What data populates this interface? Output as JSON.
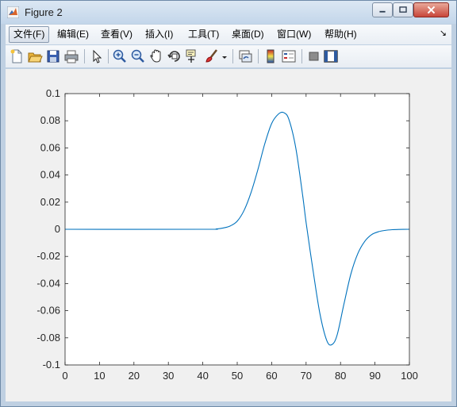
{
  "window": {
    "title": "Figure 2"
  },
  "menu": {
    "items": [
      "文件(F)",
      "编辑(E)",
      "查看(V)",
      "插入(I)",
      "工具(T)",
      "桌面(D)",
      "窗口(W)",
      "帮助(H)"
    ]
  },
  "toolbar": {
    "icons": [
      "new-figure-icon",
      "open-file-icon",
      "save-icon",
      "print-icon",
      "edit-plot-icon",
      "zoom-in-icon",
      "zoom-out-icon",
      "pan-icon",
      "rotate-3d-icon",
      "data-cursor-icon",
      "brush-icon",
      "link-plot-icon",
      "colorbar-icon",
      "legend-icon",
      "hide-plot-tools-icon",
      "show-plot-tools-icon"
    ]
  },
  "colors": {
    "line": "#0072bd",
    "axes_bg": "#ffffff",
    "figure_bg": "#f0f0f0"
  },
  "chart_data": {
    "type": "line",
    "x_ticks": [
      "0",
      "10",
      "20",
      "30",
      "40",
      "50",
      "60",
      "70",
      "80",
      "90",
      "100"
    ],
    "y_ticks": [
      "0.1",
      "0.08",
      "0.06",
      "0.04",
      "0.02",
      "0",
      "-0.02",
      "-0.04",
      "-0.06",
      "-0.08",
      "-0.1"
    ],
    "xlim": [
      0,
      100
    ],
    "ylim": [
      -0.1,
      0.1
    ],
    "grid": false,
    "series": [
      {
        "x": [
          0,
          40,
          44,
          46,
          48,
          50,
          52,
          54,
          56,
          58,
          60,
          62,
          63.5,
          65,
          67,
          69,
          70,
          72,
          74,
          76,
          77.5,
          79,
          81,
          83,
          85,
          87,
          89,
          91,
          93,
          95,
          97,
          100
        ],
        "y": [
          0,
          0,
          0.0003,
          0.001,
          0.0025,
          0.006,
          0.014,
          0.027,
          0.044,
          0.063,
          0.078,
          0.085,
          0.086,
          0.081,
          0.06,
          0.025,
          0.005,
          -0.03,
          -0.062,
          -0.082,
          -0.085,
          -0.078,
          -0.055,
          -0.033,
          -0.018,
          -0.009,
          -0.004,
          -0.0018,
          -0.0008,
          -0.0003,
          -0.0001,
          0
        ]
      }
    ]
  }
}
